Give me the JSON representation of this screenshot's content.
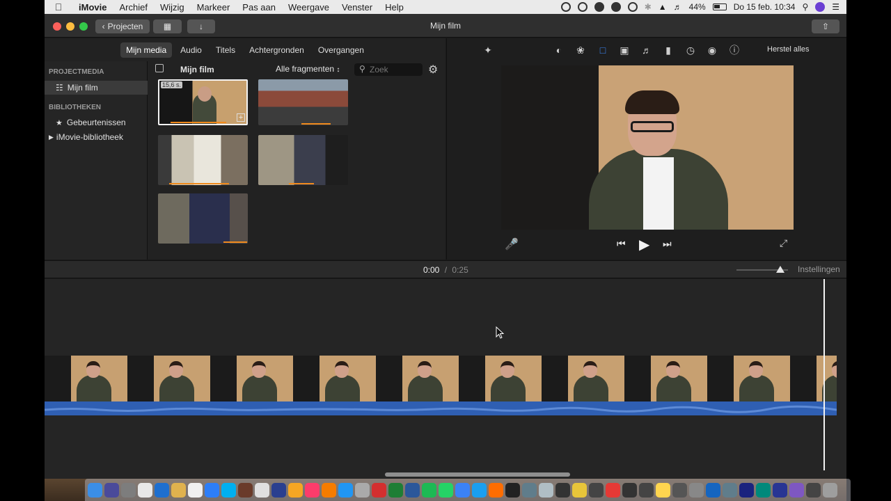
{
  "menubar": {
    "app_name": "iMovie",
    "items": [
      "Archief",
      "Wijzig",
      "Markeer",
      "Pas aan",
      "Weergave",
      "Venster",
      "Help"
    ],
    "battery": "44%",
    "clock": "Do 15 feb. 10:34"
  },
  "window": {
    "title": "Mijn film",
    "projects_button": "Projecten"
  },
  "browser": {
    "tabs": [
      "Mijn media",
      "Audio",
      "Titels",
      "Achtergronden",
      "Overgangen"
    ],
    "active_tab": "Mijn media",
    "library": {
      "project_media_header": "PROJECTMEDIA",
      "project_item": "Mijn film",
      "libraries_header": "BIBLIOTHEKEN",
      "events_item": "Gebeurtenissen",
      "library_item": "iMovie-bibliotheek"
    },
    "media_title": "Mijn film",
    "filter": "Alle fragmenten",
    "search_placeholder": "Zoek",
    "selected_clip_duration": "15,6 s."
  },
  "viewer": {
    "reset_all": "Herstel alles"
  },
  "timeline": {
    "current_time": "0:00",
    "separator": "/",
    "total_time": "0:25",
    "settings": "Instellingen"
  },
  "colors": {
    "accent_orange": "#f08a1c",
    "audio_blue": "#2f5fb3",
    "crop_blue": "#3d8bfd"
  }
}
